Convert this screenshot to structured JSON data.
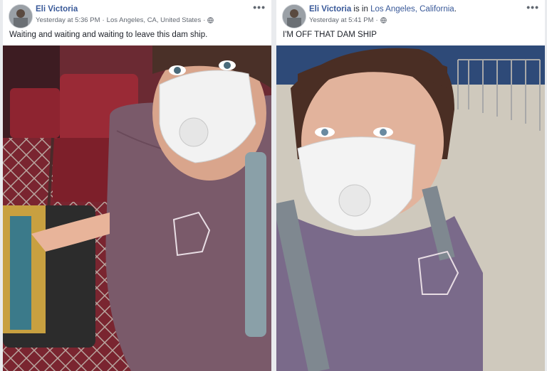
{
  "posts": [
    {
      "author": "Eli Victoria",
      "location_prefix": "",
      "location_link": "",
      "timestamp": "Yesterday at 5:36 PM",
      "location_meta": "Los Angeles, CA, United States",
      "text": "Waiting and waiting and waiting to leave this dam ship.",
      "more": "•••"
    },
    {
      "author": "Eli Victoria",
      "location_prefix": " is in ",
      "location_link": "Los Angeles, California",
      "location_suffix": ".",
      "timestamp": "Yesterday at 5:41 PM",
      "location_meta": "",
      "text": "I'M OFF THAT DAM SHIP",
      "more": "•••"
    }
  ],
  "colors": {
    "link": "#385898",
    "meta": "#616770",
    "bg": "#e9ebee"
  },
  "icons": [
    "globe-icon",
    "more-options-icon"
  ]
}
